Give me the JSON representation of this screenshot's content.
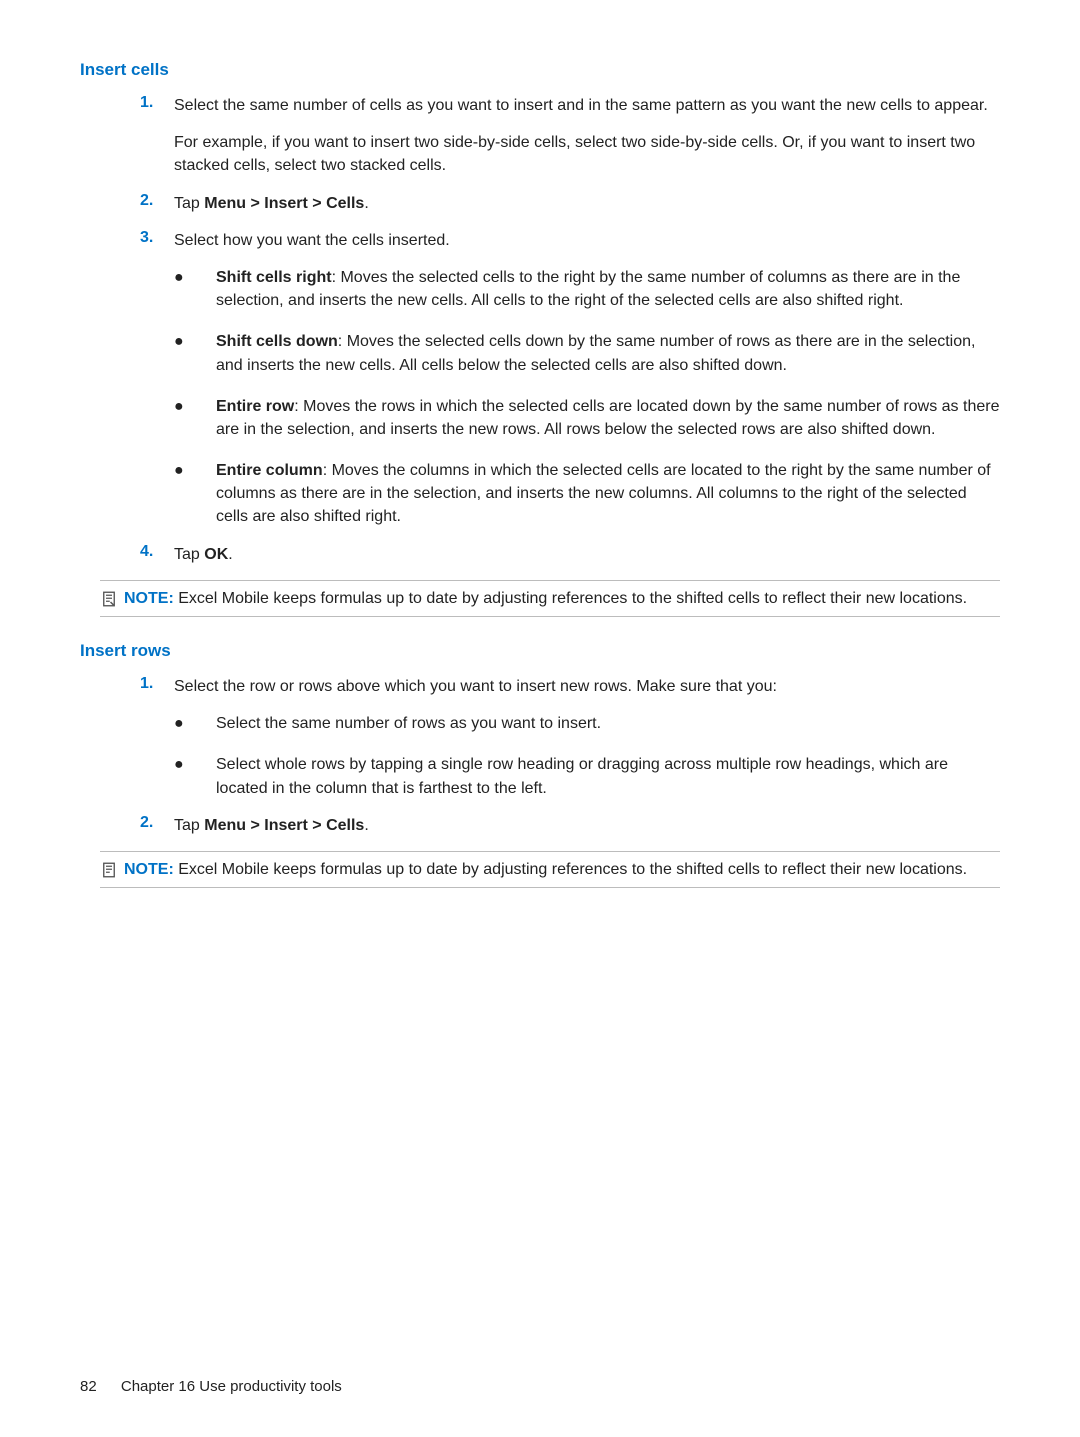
{
  "colors": {
    "accent": "#0072c6"
  },
  "section1": {
    "heading": "Insert cells",
    "step1_a": "Select the same number of cells as you want to insert and in the same pattern as you want the new cells to appear.",
    "step1_b": "For example, if you want to insert two side-by-side cells, select two side-by-side cells. Or, if you want to insert two stacked cells, select two stacked cells.",
    "step2_pre": "Tap ",
    "step2_bold": "Menu > Insert > Cells",
    "step2_post": ".",
    "step3_intro": "Select how you want the cells inserted.",
    "bullets": [
      {
        "term": "Shift cells right",
        "rest": ": Moves the selected cells to the right by the same number of columns as there are in the selection, and inserts the new cells. All cells to the right of the selected cells are also shifted right."
      },
      {
        "term": "Shift cells down",
        "rest": ": Moves the selected cells down by the same number of rows as there are in the selection, and inserts the new cells. All cells below the selected cells are also shifted down."
      },
      {
        "term": "Entire row",
        "rest": ": Moves the rows in which the selected cells are located down by the same number of rows as there are in the selection, and inserts the new rows. All rows below the selected rows are also shifted down."
      },
      {
        "term": "Entire column",
        "rest": ": Moves the columns in which the selected cells are located to the right by the same number of columns as there are in the selection, and inserts the new columns. All columns to the right of the selected cells are also shifted right."
      }
    ],
    "step4_pre": "Tap ",
    "step4_bold": "OK",
    "step4_post": "."
  },
  "note1": {
    "label": "NOTE:",
    "text": "Excel Mobile keeps formulas up to date by adjusting references to the shifted cells to reflect their new locations."
  },
  "section2": {
    "heading": "Insert rows",
    "step1_intro": "Select the row or rows above which you want to insert new rows. Make sure that you:",
    "bullets": [
      "Select the same number of rows as you want to insert.",
      "Select whole rows by tapping a single row heading or dragging across multiple row headings, which are located in the column that is farthest to the left."
    ],
    "step2_pre": "Tap ",
    "step2_bold": "Menu > Insert > Cells",
    "step2_post": "."
  },
  "note2": {
    "label": "NOTE:",
    "text": "Excel Mobile keeps formulas up to date by adjusting references to the shifted cells to reflect their new locations."
  },
  "numbers": {
    "n1": "1.",
    "n2": "2.",
    "n3": "3.",
    "n4": "4."
  },
  "footer": {
    "page": "82",
    "chapter": "Chapter 16   Use productivity tools"
  }
}
